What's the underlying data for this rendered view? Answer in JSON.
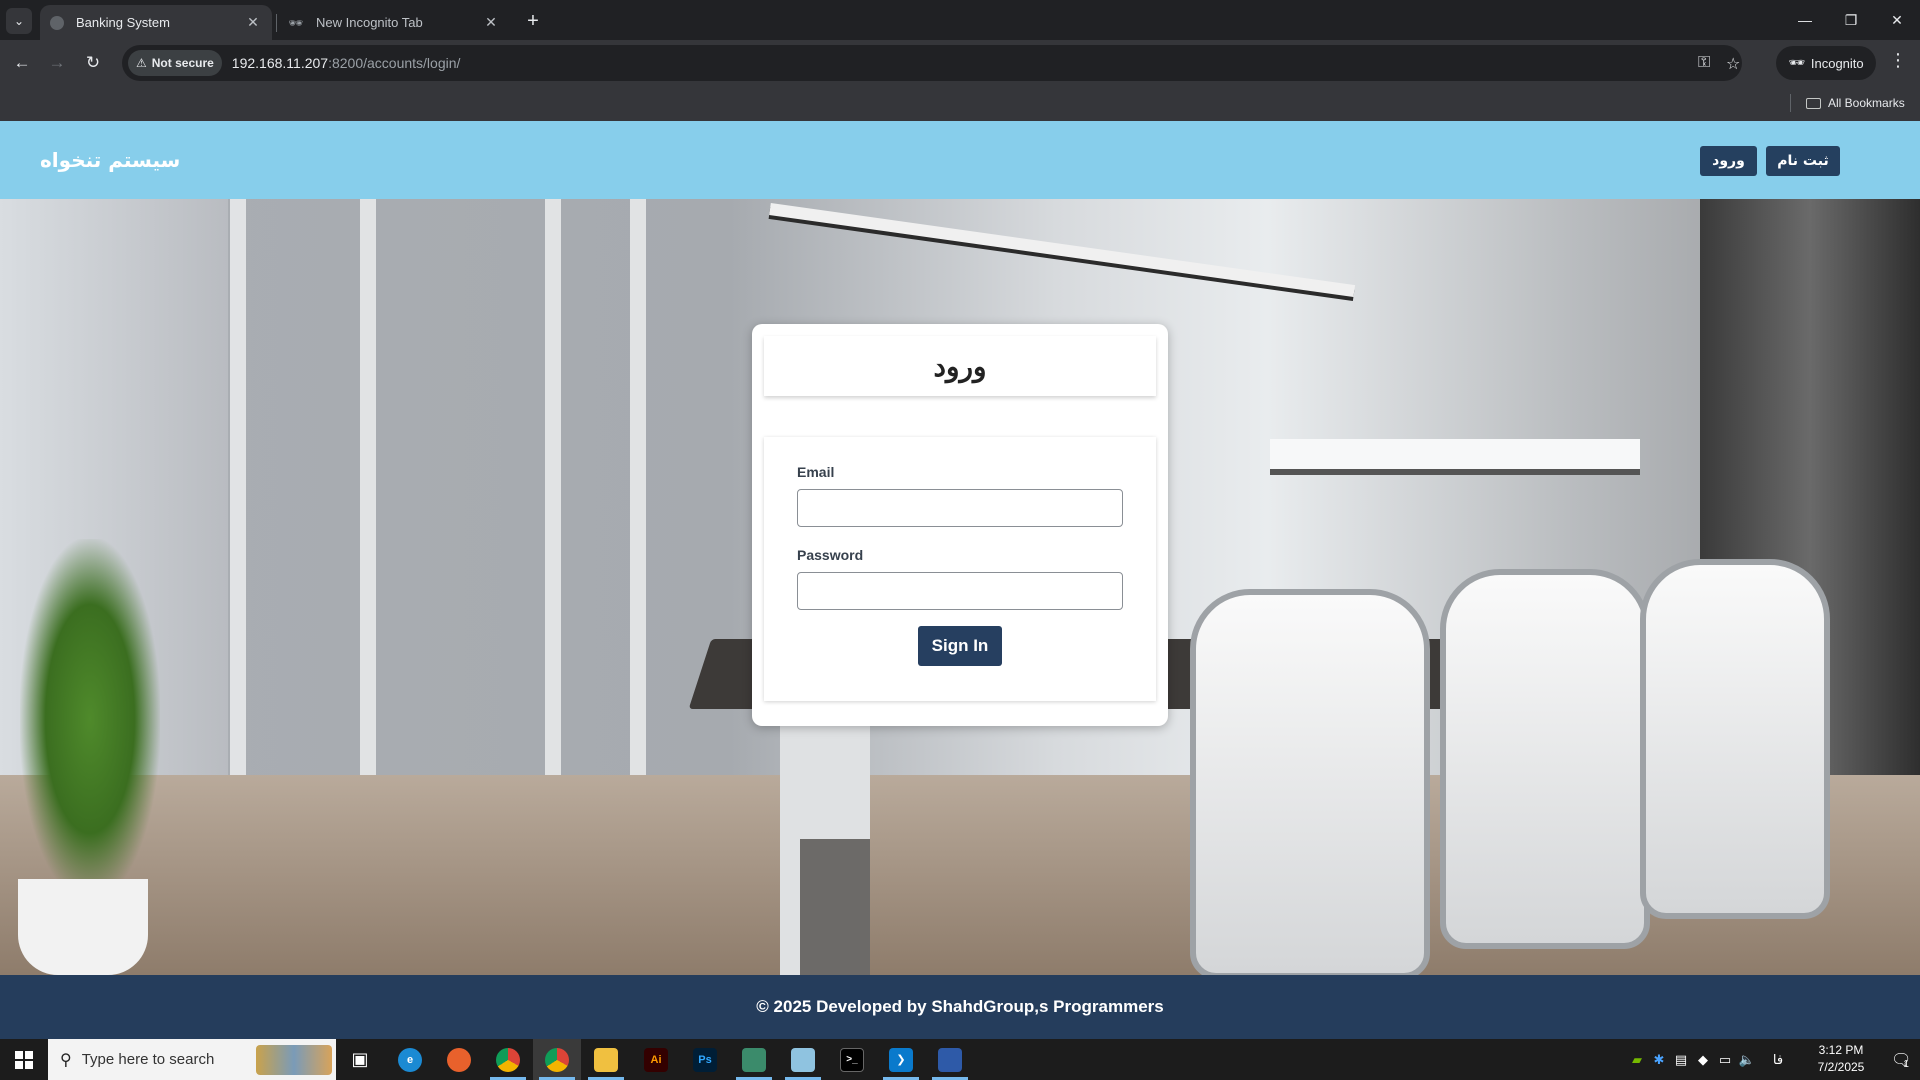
{
  "browser": {
    "tabs": [
      {
        "title": "Banking System",
        "active": true
      },
      {
        "title": "New Incognito Tab",
        "active": false
      }
    ],
    "security_chip": "Not secure",
    "url_host": "192.168.11.207",
    "url_rest": ":8200/accounts/login/",
    "incognito_label": "Incognito",
    "bookmarks_label": "All Bookmarks"
  },
  "site": {
    "brand": "سیستم تنخواه",
    "nav": {
      "register": "ثبت نام",
      "login": "ورود"
    },
    "colors": {
      "header": "#87ceeb",
      "primary": "#253d5c"
    }
  },
  "login": {
    "title": "ورود",
    "email_label": "Email",
    "email_value": "",
    "password_label": "Password",
    "password_value": "",
    "submit_label": "Sign In"
  },
  "footer": {
    "text": "© 2025 Developed by ShahdGroup,s Programmers"
  },
  "taskbar": {
    "search_placeholder": "Type here to search",
    "apps": [
      "task-view",
      "edge",
      "firefox",
      "chrome",
      "chrome-incognito",
      "file-explorer",
      "illustrator",
      "photoshop",
      "network-tool",
      "notepad",
      "terminal",
      "vscode",
      "network-manager"
    ],
    "language": "فا",
    "time": "3:12 PM",
    "date": "7/2/2025",
    "notification_count": "1"
  }
}
